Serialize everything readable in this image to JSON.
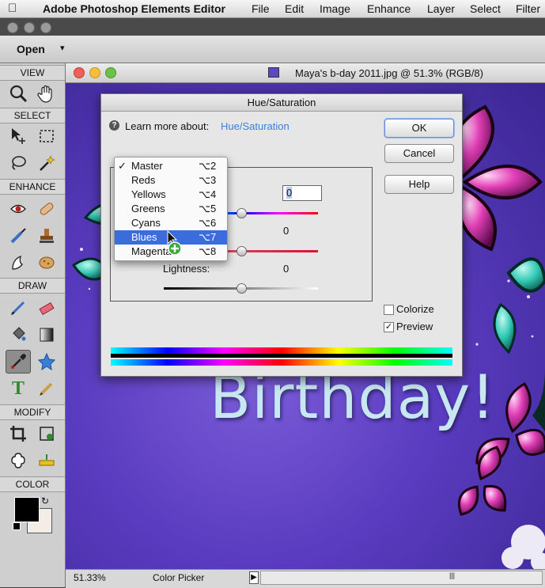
{
  "menubar": {
    "app_name": "Adobe Photoshop Elements Editor",
    "items": [
      "File",
      "Edit",
      "Image",
      "Enhance",
      "Layer",
      "Select",
      "Filter"
    ]
  },
  "topbar": {
    "open_label": "Open"
  },
  "toolbox": {
    "sections": [
      "VIEW",
      "SELECT",
      "ENHANCE",
      "DRAW",
      "MODIFY",
      "COLOR"
    ]
  },
  "document": {
    "title": "Maya's b-day 2011.jpg @ 51.3% (RGB/8)",
    "canvas_text": "Birthday!",
    "status_zoom": "51.33%",
    "status_tool": "Color Picker"
  },
  "dialog": {
    "title": "Hue/Saturation",
    "learn_more_label": "Learn more about:",
    "learn_more_link": "Hue/Saturation",
    "ok": "OK",
    "cancel": "Cancel",
    "help": "Help",
    "hue_value": "0",
    "saturation_value": "0",
    "lightness_label": "Lightness:",
    "lightness_value": "0",
    "colorize_label": "Colorize",
    "preview_label": "Preview",
    "colorize_checked": false,
    "preview_checked": true
  },
  "channel_menu": {
    "items": [
      {
        "label": "Master",
        "shortcut": "⌥2",
        "checked": true
      },
      {
        "label": "Reds",
        "shortcut": "⌥3"
      },
      {
        "label": "Yellows",
        "shortcut": "⌥4"
      },
      {
        "label": "Greens",
        "shortcut": "⌥5"
      },
      {
        "label": "Cyans",
        "shortcut": "⌥6"
      },
      {
        "label": "Blues",
        "shortcut": "⌥7",
        "highlighted": true
      },
      {
        "label": "Magenta",
        "shortcut": "⌥8"
      }
    ]
  },
  "colors": {
    "highlight": "#3c6bde",
    "link": "#3d7fd9",
    "canvas_purple": "#5a3cc0"
  }
}
